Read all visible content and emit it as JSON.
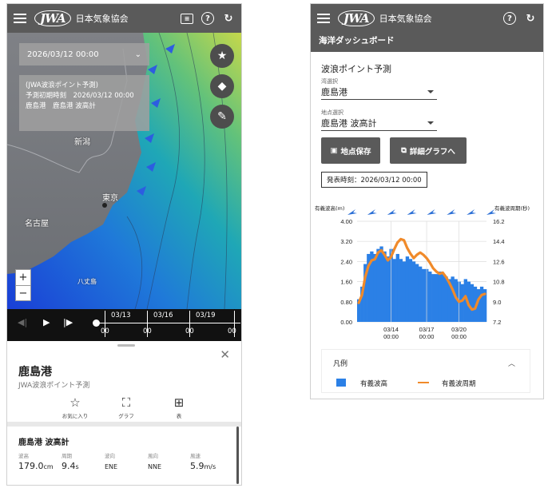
{
  "app": {
    "logo": "JWA",
    "org_name": "日本気象協会"
  },
  "left": {
    "date_select": "2026/03/12 00:00",
    "info": {
      "line1": "(JWA波浪ポイント予測)",
      "line2": "予測初期時刻　2026/03/12 00:00",
      "line3": "鹿島港　鹿島港 波高計"
    },
    "map_labels": {
      "niigata": "新潟",
      "tokyo": "東京",
      "nagoya": "名古屋",
      "hachijo": "八丈島"
    },
    "zoom": {
      "plus": "+",
      "minus": "−"
    },
    "timeline": {
      "dates": [
        "03/13",
        "03/16",
        "03/19"
      ],
      "hours": [
        "00",
        "00",
        "00",
        "00"
      ]
    },
    "detail": {
      "name": "鹿島港",
      "subtitle": "JWA波浪ポイント予測",
      "actions": [
        {
          "icon": "☆",
          "label": "お気に入り"
        },
        {
          "icon": "⛶",
          "label": "グラフ"
        },
        {
          "icon": "⊞",
          "label": "表"
        }
      ],
      "sensor_title": "鹿島港 波高計",
      "observations": [
        {
          "label": "波高",
          "value": "179.0",
          "unit": "cm"
        },
        {
          "label": "周期",
          "value": "9.4",
          "unit": "s"
        },
        {
          "label": "波向",
          "value": "ENE",
          "unit": ""
        },
        {
          "label": "風向",
          "value": "NNE",
          "unit": ""
        },
        {
          "label": "風速",
          "value": "5.9",
          "unit": "m/s"
        }
      ]
    }
  },
  "right": {
    "subtitle": "海洋ダッシュボード",
    "heading": "波浪ポイント予測",
    "bay_label": "湾選択",
    "bay_value": "鹿島港",
    "point_label": "地点選択",
    "point_value": "鹿島港 波高計",
    "save_button": "地点保存",
    "detail_button": "詳細グラフへ",
    "issued": "発表時刻：2026/03/12 00:00",
    "legend": {
      "title": "凡例",
      "bar_label": "有義波高",
      "line_label": "有義波周期"
    }
  },
  "chart_data": {
    "type": "bar",
    "title": "",
    "ylabel": "有義波高(m)",
    "y2label": "有義波周期(秒)",
    "ylim": [
      0,
      4.0
    ],
    "y2lim": [
      7.2,
      16.2
    ],
    "yticks": [
      "4.00",
      "3.20",
      "2.40",
      "1.60",
      "0.80",
      "0.00"
    ],
    "y2ticks": [
      "16.2",
      "14.4",
      "12.6",
      "10.8",
      "9.0",
      "7.2"
    ],
    "xticks": [
      {
        "label": "03/14",
        "sub": "00:00"
      },
      {
        "label": "03/17",
        "sub": "00:00"
      },
      {
        "label": "03/20",
        "sub": "00:00"
      }
    ],
    "series": [
      {
        "name": "有義波高",
        "values": [
          0.9,
          1.4,
          2.3,
          2.7,
          2.8,
          2.7,
          2.9,
          3.0,
          2.8,
          2.6,
          2.9,
          2.5,
          2.7,
          2.5,
          2.4,
          2.6,
          2.5,
          2.4,
          2.3,
          2.2,
          2.1,
          2.1,
          2.0,
          1.9,
          1.9,
          2.0,
          1.9,
          1.8,
          1.7,
          1.8,
          1.7,
          1.6,
          1.5,
          1.7,
          1.6,
          1.5,
          1.4,
          1.3,
          1.4,
          1.3
        ]
      },
      {
        "name": "有義波周期",
        "values": [
          8.9,
          9.6,
          11.2,
          12.2,
          12.7,
          12.8,
          13.4,
          13.6,
          13.2,
          12.7,
          13.0,
          13.7,
          14.3,
          14.6,
          14.5,
          13.8,
          13.3,
          12.9,
          13.2,
          13.4,
          13.2,
          12.9,
          12.5,
          12.0,
          11.7,
          11.5,
          11.6,
          11.2,
          10.7,
          10.1,
          9.4,
          9.0,
          9.1,
          9.5,
          8.7,
          8.3,
          8.4,
          9.2,
          9.6,
          9.7
        ]
      }
    ],
    "x_ticks_index": [
      10,
      21,
      31
    ],
    "wind_arrow_count": 8
  }
}
